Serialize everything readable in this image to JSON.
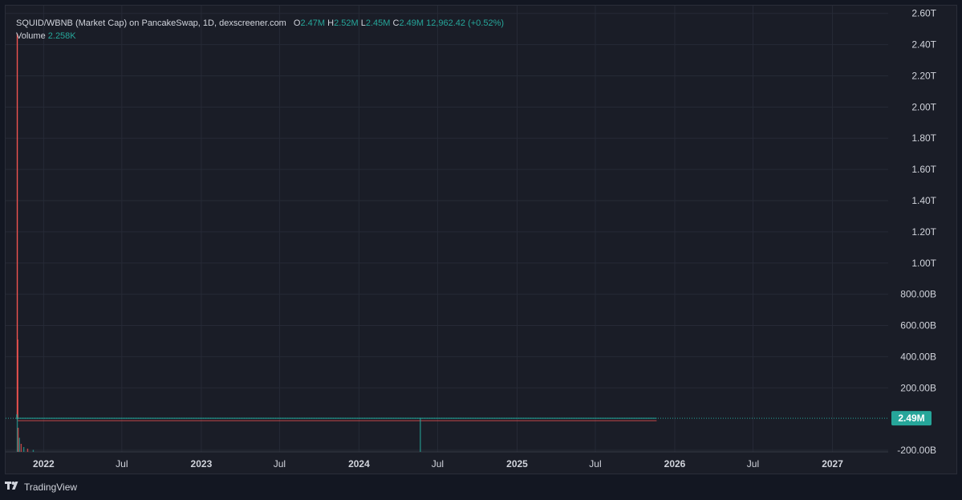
{
  "legend": {
    "title": "SQUID/WBNB (Market Cap) on PancakeSwap, 1D, dexscreener.com",
    "open_key": "O",
    "open": "2.47M",
    "high_key": "H",
    "high": "2.52M",
    "low_key": "L",
    "low": "2.45M",
    "close_key": "C",
    "close": "2.49M",
    "change": "12,962.42 (+0.52%)",
    "volume_label": "Volume",
    "volume_value": "2.258K"
  },
  "price_tag": "2.49M",
  "footer": {
    "brand": "TradingView",
    "logo_icon": "tradingview-logo-icon"
  },
  "colors": {
    "background": "#131722",
    "panel": "#1a1d27",
    "grid": "#262a36",
    "up": "#26a69a",
    "down": "#ef5350",
    "text": "#d1d4dc"
  },
  "chart_data": {
    "type": "line",
    "title": "",
    "y_unit": "market cap (USD)",
    "ylim": [
      -210000000000,
      2650000000000
    ],
    "y_ticks": [
      "2.60T",
      "2.40T",
      "2.20T",
      "2.00T",
      "1.80T",
      "1.60T",
      "1.40T",
      "1.20T",
      "1.00T",
      "800.00B",
      "600.00B",
      "400.00B",
      "200.00B",
      "-200.00B"
    ],
    "y_tick_values": [
      2600000000000,
      2400000000000,
      2200000000000,
      2000000000000,
      1800000000000,
      1600000000000,
      1400000000000,
      1200000000000,
      1000000000000,
      800000000000,
      600000000000,
      400000000000,
      200000000000,
      -200000000000
    ],
    "x_ticks": [
      "2022",
      "Jul",
      "2023",
      "Jul",
      "2024",
      "Jul",
      "2025",
      "Jul",
      "2026",
      "Jul",
      "2027"
    ],
    "x_tick_dates": [
      "2022-01-01",
      "2022-07-01",
      "2023-01-01",
      "2023-07-01",
      "2024-01-01",
      "2024-07-01",
      "2025-01-01",
      "2025-07-01",
      "2026-01-01",
      "2026-07-01",
      "2027-01-01"
    ],
    "x_year_ticks": [
      "2022",
      "2023",
      "2024",
      "2025",
      "2026",
      "2027"
    ],
    "xlim": [
      "2021-10-05",
      "2027-05-10"
    ],
    "grid": true,
    "spikes": [
      {
        "date": "2021-11-01",
        "high": 2470000000000,
        "low": 0,
        "direction": "down"
      },
      {
        "date": "2021-11-02",
        "high": 510000000000,
        "low": 0,
        "direction": "down"
      },
      {
        "date": "2021-10-31",
        "high": 30000000000,
        "low": 0,
        "direction": "up"
      }
    ],
    "volume_spikes": [
      {
        "date": "2021-11-01",
        "level": 1.0,
        "direction": "up"
      },
      {
        "date": "2021-11-03",
        "level": 0.6,
        "direction": "down"
      },
      {
        "date": "2021-11-06",
        "level": 0.35,
        "direction": "up"
      },
      {
        "date": "2021-11-10",
        "level": 0.2,
        "direction": "down"
      },
      {
        "date": "2021-11-16",
        "level": 0.12,
        "direction": "up"
      },
      {
        "date": "2021-11-25",
        "level": 0.08,
        "direction": "down"
      },
      {
        "date": "2021-12-08",
        "level": 0.05,
        "direction": "up"
      },
      {
        "date": "2024-05-22",
        "level": 0.85,
        "direction": "up"
      }
    ],
    "series_end_date": "2025-11-20",
    "last_close": 2490000
  }
}
